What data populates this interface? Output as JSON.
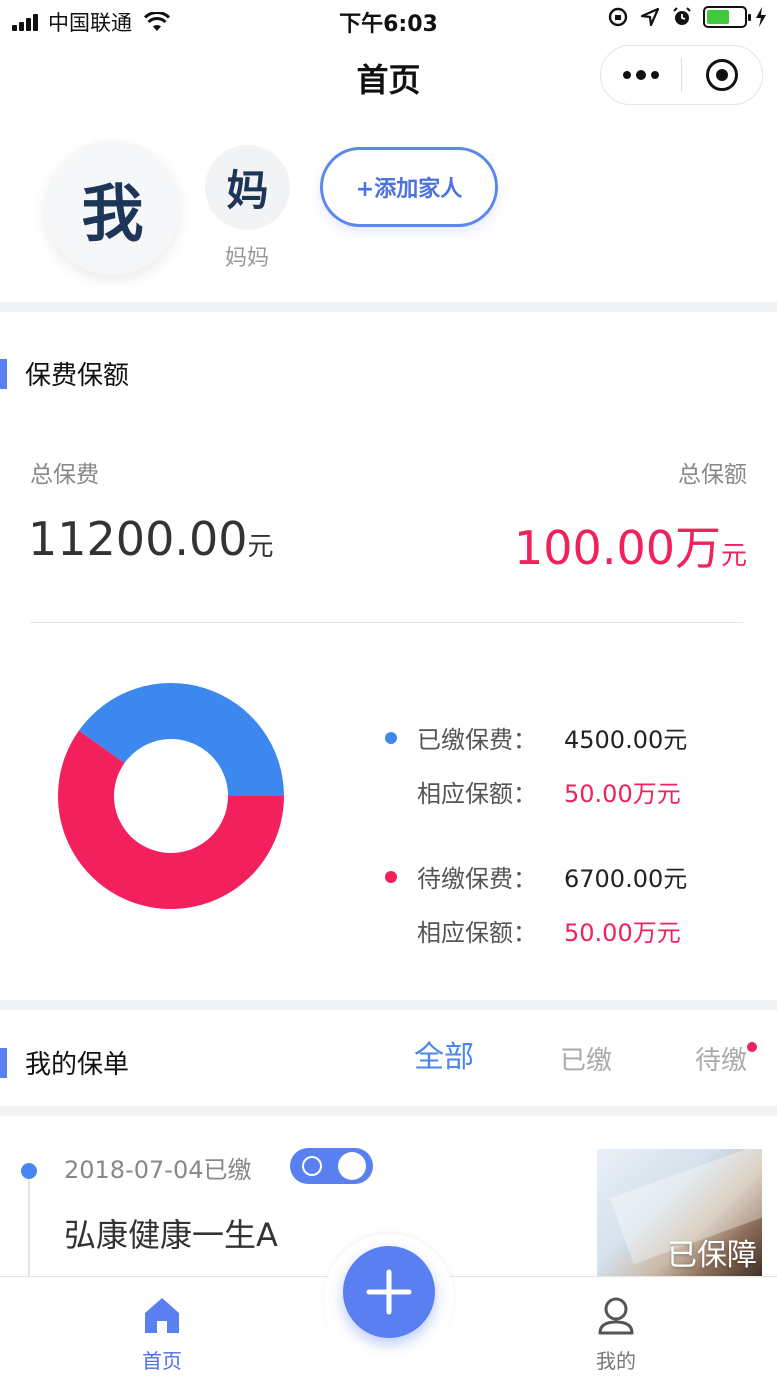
{
  "status_bar": {
    "carrier": "中国联通",
    "time": "下午6:03"
  },
  "nav": {
    "title": "首页"
  },
  "family": {
    "me": "我",
    "mom_avatar": "妈",
    "mom_label": "妈妈",
    "add_button": "+添加家人"
  },
  "premium": {
    "section_title": "保费保额",
    "total_premium_label": "总保费",
    "total_coverage_label": "总保额",
    "total_premium_value": "11200.00",
    "total_premium_unit": "元",
    "total_coverage_value": "100.00万",
    "total_coverage_unit": "元",
    "paid_label": "已缴保费：",
    "paid_value": "4500.00元",
    "paid_cov_label": "相应保额：",
    "paid_cov_value": "50.00万元",
    "pending_label": "待缴保费：",
    "pending_value": "6700.00元",
    "pending_cov_label": "相应保额：",
    "pending_cov_value": "50.00万元"
  },
  "chart_data": {
    "type": "pie",
    "series": [
      {
        "name": "已缴保费",
        "value": 4500,
        "color": "#3d88ee"
      },
      {
        "name": "待缴保费",
        "value": 6700,
        "color": "#f2215e"
      }
    ]
  },
  "policies": {
    "section_title": "我的保单",
    "tabs": [
      "全部",
      "已缴",
      "待缴"
    ],
    "active_tab": "全部",
    "items": [
      {
        "date_status": "2018-07-04已缴",
        "name": "弘康健康一生A",
        "badge": "已保障"
      }
    ]
  },
  "tabbar": {
    "home": "首页",
    "mine": "我的"
  },
  "colors": {
    "accent": "#5a7ff0",
    "pink": "#f0215c",
    "blue": "#3d88ee"
  }
}
